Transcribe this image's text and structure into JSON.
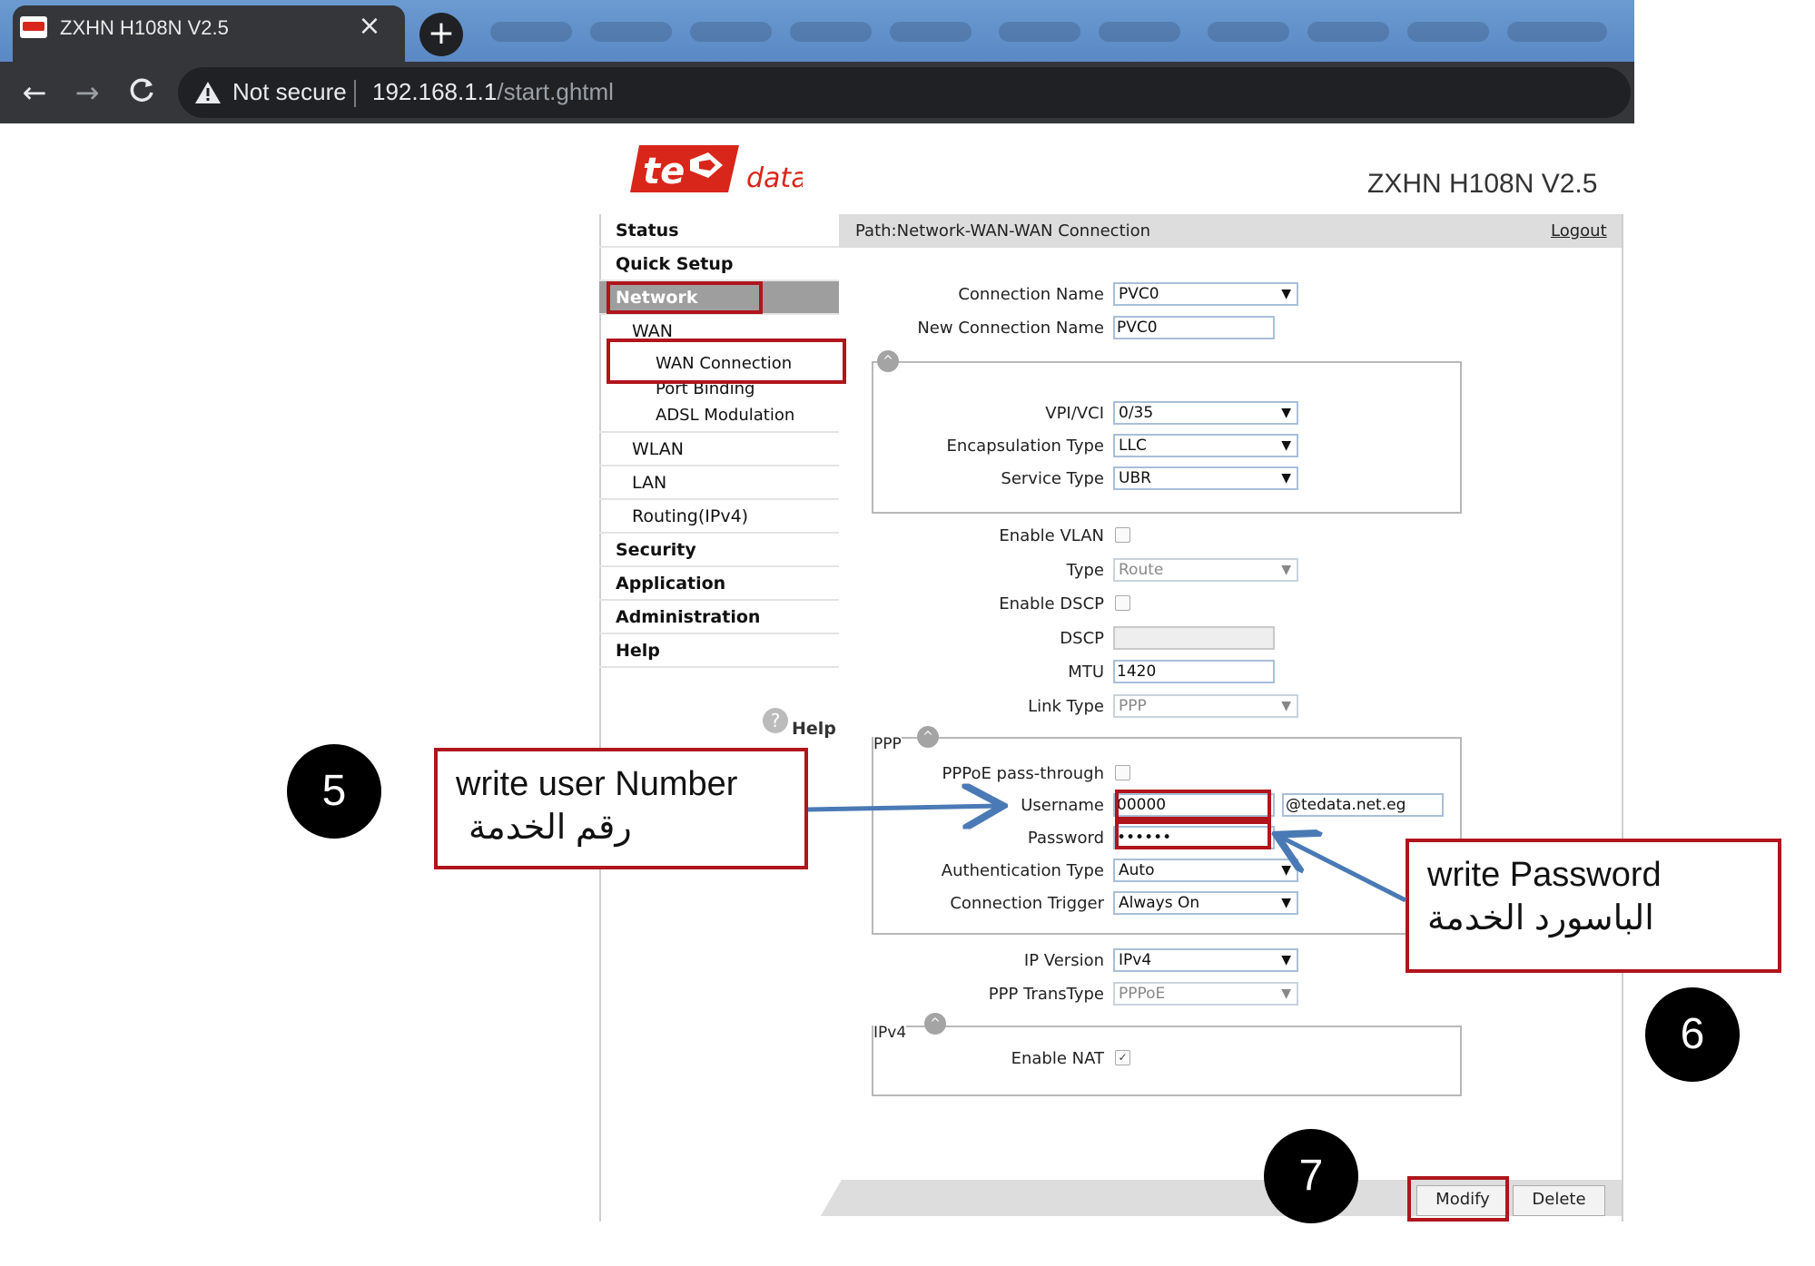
{
  "browser": {
    "tab_title": "ZXHN H108N V2.5",
    "close_glyph": "×",
    "new_tab_glyph": "+",
    "back_glyph": "←",
    "forward_glyph": "→",
    "reload_glyph": "C",
    "security_text": "Not secure",
    "url_host": "192.168.1.1",
    "url_path": "/start.ghtml"
  },
  "header": {
    "logo_text": "te data",
    "logo_main": "te",
    "logo_sub": "data",
    "model": "ZXHN H108N V2.5"
  },
  "menu": {
    "status": "Status",
    "quick_setup": "Quick Setup",
    "network": "Network",
    "wan": "WAN",
    "wan_connection": "WAN Connection",
    "port_binding": "Port Binding",
    "adsl_modulation": "ADSL Modulation",
    "wlan": "WLAN",
    "lan": "LAN",
    "routing": "Routing(IPv4)",
    "security": "Security",
    "application": "Application",
    "administration": "Administration",
    "help": "Help",
    "help_link": "Help",
    "help_glyph": "?"
  },
  "path": {
    "text": "Path:Network-WAN-WAN Connection",
    "logout": "Logout"
  },
  "form": {
    "connection_name_label": "Connection Name",
    "connection_name_value": "PVC0",
    "new_connection_name_label": "New Connection Name",
    "new_connection_name_value": "PVC0",
    "vpi_vci_label": "VPI/VCI",
    "vpi_vci_value": "0/35",
    "encapsulation_label": "Encapsulation Type",
    "encapsulation_value": "LLC",
    "service_type_label": "Service Type",
    "service_type_value": "UBR",
    "enable_vlan_label": "Enable VLAN",
    "type_label": "Type",
    "type_value": "Route",
    "enable_dscp_label": "Enable DSCP",
    "dscp_label": "DSCP",
    "dscp_value": "",
    "mtu_label": "MTU",
    "mtu_value": "1420",
    "link_type_label": "Link Type",
    "link_type_value": "PPP",
    "ppp_legend": "PPP",
    "pppoe_passthrough_label": "PPPoE pass-through",
    "username_label": "Username",
    "username_value": "00000",
    "username_suffix": "@tedata.net.eg",
    "password_label": "Password",
    "password_value": "••••••",
    "auth_type_label": "Authentication Type",
    "auth_type_value": "Auto",
    "conn_trigger_label": "Connection Trigger",
    "conn_trigger_value": "Always On",
    "ip_version_label": "IP Version",
    "ip_version_value": "IPv4",
    "ppp_transtype_label": "PPP TransType",
    "ppp_transtype_value": "PPPoE",
    "ipv4_legend": "IPv4",
    "enable_nat_label": "Enable NAT",
    "enable_nat_checked": "✓",
    "dropdown_arrow": "▼",
    "collapse_glyph": "^"
  },
  "buttons": {
    "modify": "Modify",
    "delete": "Delete"
  },
  "annotations": {
    "callout_user_en": "write user Number",
    "callout_user_ar": "رقم الخدمة",
    "callout_pass_en": "write Password",
    "callout_pass_ar": "الباسورد الخدمة",
    "step5": "5",
    "step6": "6",
    "step7": "7"
  },
  "colors": {
    "highlight_red": "#b0151c",
    "arrow_blue": "#4a7ab5",
    "logo_red": "#d8261b"
  }
}
